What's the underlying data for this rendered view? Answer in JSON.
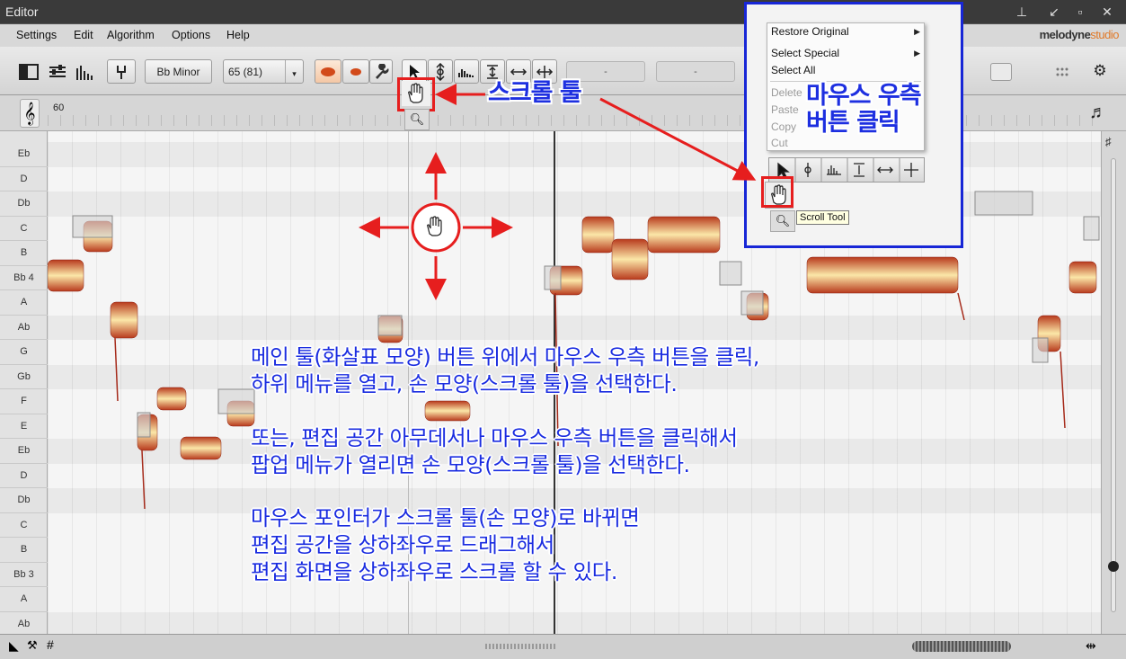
{
  "window": {
    "title": "Editor"
  },
  "menu": {
    "items": [
      "Settings",
      "Edit",
      "Algorithm",
      "Options",
      "Help"
    ]
  },
  "logo": {
    "brand": "melodyne",
    "edition": "studio"
  },
  "toolbar": {
    "key": "Bb Minor",
    "tempo": "65 (81)",
    "field1": "-",
    "field2": "-"
  },
  "ruler": {
    "bar": "60"
  },
  "pitches": [
    "Eb",
    "D",
    "Db",
    "C",
    "B",
    "Bb 4",
    "A",
    "Ab",
    "G",
    "Gb",
    "F",
    "E",
    "Eb",
    "D",
    "Db",
    "C",
    "B",
    "Bb 3",
    "A",
    "Ab"
  ],
  "context_menu": {
    "items": [
      {
        "label": "Restore Original",
        "submenu": true,
        "enabled": true
      },
      {
        "label": "Select Special",
        "submenu": true,
        "enabled": true
      },
      {
        "label": "Select All",
        "submenu": false,
        "enabled": true
      },
      {
        "label": "Delete",
        "submenu": false,
        "enabled": false
      },
      {
        "label": "Paste",
        "submenu": false,
        "enabled": false
      },
      {
        "label": "Copy",
        "submenu": false,
        "enabled": false
      },
      {
        "label": "Cut",
        "submenu": false,
        "enabled": false
      }
    ],
    "tooltip": "Scroll Tool"
  },
  "annotations": {
    "scroll_tool": "스크롤 툴",
    "right_click_line1": "마우스 우측",
    "right_click_line2": "버튼 클릭",
    "body_lines": [
      "메인 툴(화살표 모양) 버튼 위에서 마우스 우측 버튼을 클릭,",
      "하위 메뉴를 열고, 손 모양(스크롤 툴)을 선택한다.",
      "",
      "또는, 편집 공간 아무데서나 마우스 우측 버튼을 클릭해서",
      "팝업 메뉴가 열리면 손 모양(스크롤 툴)을 선택한다.",
      "",
      "마우스 포인터가 스크롤 툴(손 모양)로 바뀌면",
      "편집 공간을 상하좌우로 드래그해서",
      "편집 화면을 상하좌우로 스크롤 할 수 있다."
    ]
  },
  "colors": {
    "annotation_red": "#e61e1e",
    "annotation_blue": "#1a2ce0",
    "inset_border": "#1726d6"
  }
}
